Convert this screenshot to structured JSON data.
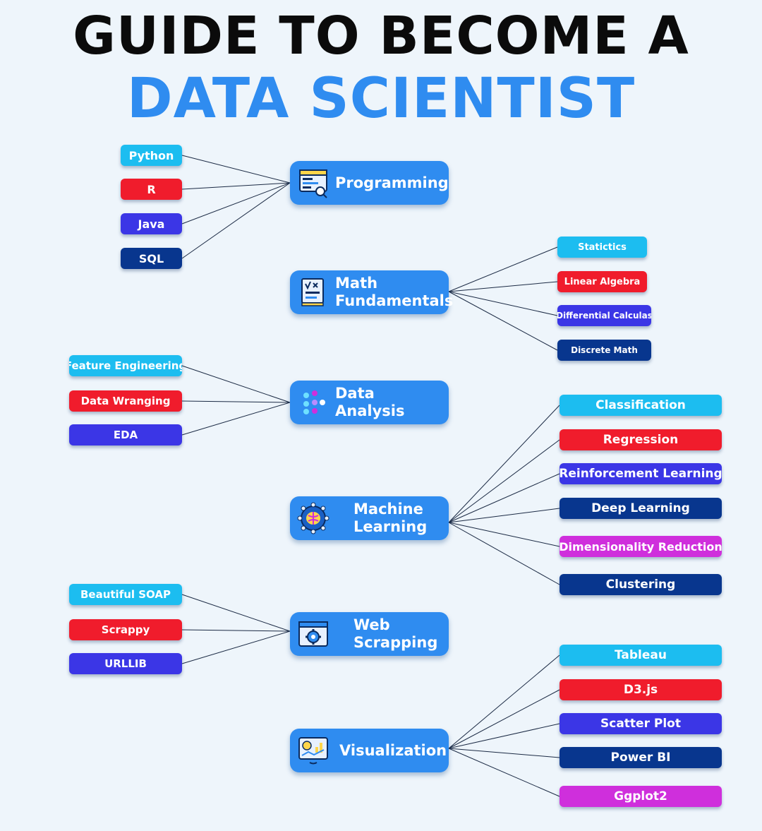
{
  "title": {
    "line1": "GUIDE TO BECOME A",
    "line2": "DATA SCIENTIST"
  },
  "hubs": [
    {
      "id": "programming",
      "label": "Programming",
      "icon": "code-window-icon"
    },
    {
      "id": "math",
      "label": "Math\nFundamentals",
      "icon": "formula-book-icon"
    },
    {
      "id": "data-analysis",
      "label": "Data Analysis",
      "icon": "dots-cluster-icon"
    },
    {
      "id": "machine-learning",
      "label": "Machine\nLearning",
      "icon": "brain-network-icon"
    },
    {
      "id": "web-scrapping",
      "label": "Web\nScrapping",
      "icon": "browser-gear-icon"
    },
    {
      "id": "visualization",
      "label": "Visualization",
      "icon": "chart-monitor-icon"
    }
  ],
  "branches": {
    "programming": [
      "Python",
      "R",
      "Java",
      "SQL"
    ],
    "math": [
      "Statictics",
      "Linear Algebra",
      "Differential Calculas",
      "Discrete Math"
    ],
    "data_analysis": [
      "Feature Engineering",
      "Data Wranging",
      "EDA"
    ],
    "machine_learning": [
      "Classification",
      "Regression",
      "Reinforcement Learning",
      "Deep Learning",
      "Dimensionality Reduction",
      "Clustering"
    ],
    "web_scrapping": [
      "Beautiful SOAP",
      "Scrappy",
      "URLLIB"
    ],
    "visualization": [
      "Tableau",
      "D3.js",
      "Scatter Plot",
      "Power BI",
      "Ggplot2"
    ]
  },
  "colors": {
    "hub": "#2f8cf0",
    "title_accent": "#2f8cf0",
    "cyan": "#1cbdf0",
    "red": "#f01c2c",
    "purple": "#3b36e6",
    "navy": "#08368e",
    "magenta": "#cf2fdc",
    "background": "#eef5fb"
  }
}
